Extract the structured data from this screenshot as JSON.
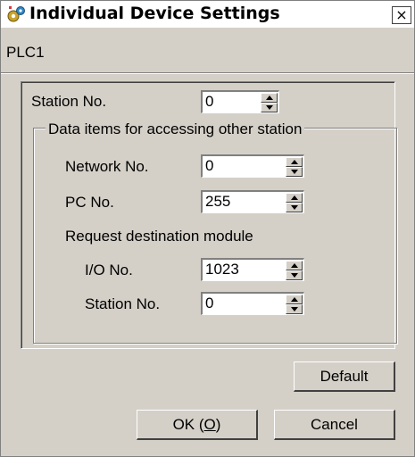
{
  "window": {
    "title": "Individual Device Settings",
    "close_glyph": "×",
    "icon": "settings-gear-icon"
  },
  "device_label": "PLC1",
  "station": {
    "label": "Station No.",
    "value": "0"
  },
  "group": {
    "legend": "Data items for accessing other station",
    "network": {
      "label": "Network No.",
      "value": "0"
    },
    "pc": {
      "label": "PC No.",
      "value": "255"
    },
    "request_title": "Request destination module",
    "io": {
      "label": "I/O No.",
      "value": "1023"
    },
    "station": {
      "label": "Station No.",
      "value": "0"
    }
  },
  "buttons": {
    "default": "Default",
    "ok": "OK (O)",
    "cancel": "Cancel"
  }
}
